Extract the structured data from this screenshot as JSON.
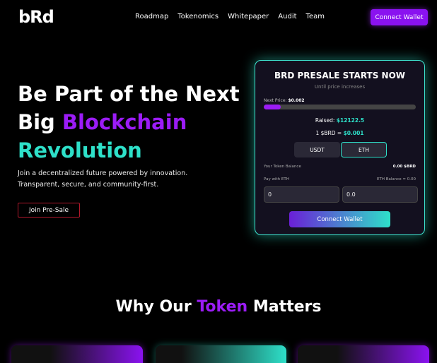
{
  "brand": {
    "logo": "bRd"
  },
  "nav": {
    "items": [
      "Roadmap",
      "Tokenomics",
      "Whitepaper",
      "Audit",
      "Team"
    ],
    "connect_label": "Connect Wallet"
  },
  "hero": {
    "line1": "Be Part of the Next",
    "line2_a": "Big ",
    "line2_b": "Blockchain",
    "line3": "Revolution",
    "sub1": "Join a decentralized future powered by innovation.",
    "sub2": "Transparent, secure, and community-first.",
    "cta": "Join Pre-Sale"
  },
  "presale": {
    "title": "BRD PRESALE STARTS NOW",
    "subtitle": "Until price increases",
    "next_price_label": "Next Price: ",
    "next_price": "$0.002",
    "progress_fraction": 0.11,
    "raised_label": "Raised: ",
    "raised": "$12122.5",
    "price_label": "1 $BRD = ",
    "price": "$0.001",
    "tokens": [
      "USDT",
      "ETH"
    ],
    "balance_label": "Your Token Balance",
    "balance": "0.00 $BRD",
    "pay_label": "Pay with ETH",
    "eth_balance": "ETH Balance = 0.00",
    "pay_value": "0",
    "receive_value": "0.0",
    "connect_label": "Connect Wallet"
  },
  "section": {
    "title_a": "Why Our ",
    "title_b": "Token",
    "title_c": " Matters"
  },
  "colors": {
    "accent_purple": "#9b1cf6",
    "accent_teal": "#2ee0c9",
    "button_purple": "#8a12f0"
  }
}
